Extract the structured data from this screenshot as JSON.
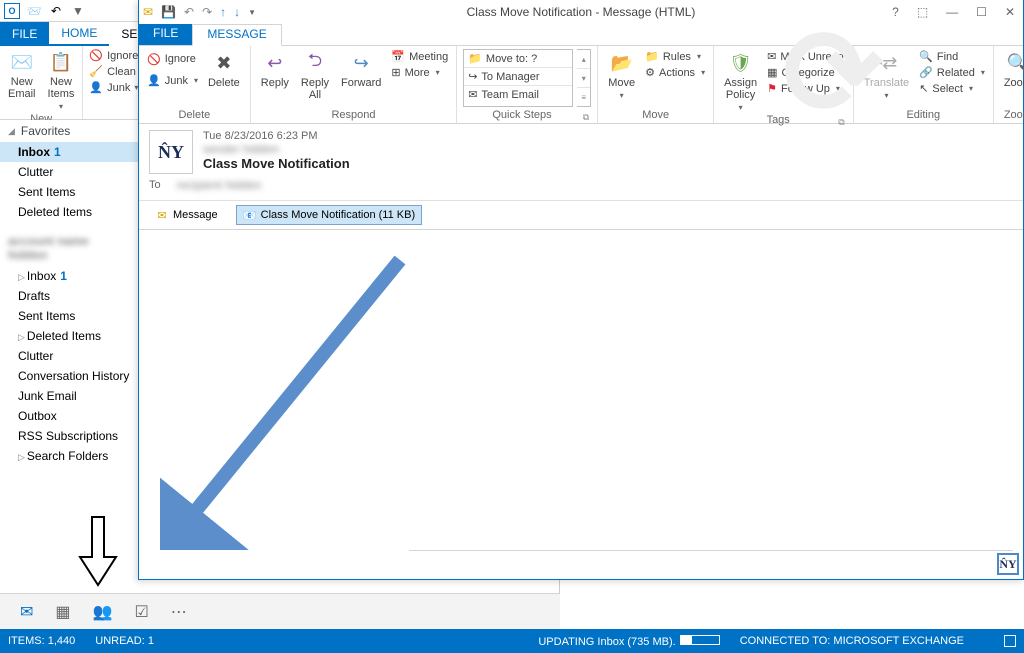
{
  "main": {
    "tabs": {
      "file": "FILE",
      "home": "HOME",
      "send_rcv": "SE"
    },
    "ribbon": {
      "new_email": "New\nEmail",
      "new_items": "New\nItems",
      "ignore": "Ignore",
      "clean": "Clean",
      "junk": "Junk",
      "group_new": "New"
    }
  },
  "nav": {
    "favorites": "Favorites",
    "inbox": "Inbox",
    "inbox_count": "1",
    "clutter": "Clutter",
    "sent": "Sent Items",
    "deleted": "Deleted Items",
    "account_blur": "account name hidden",
    "inbox2": "Inbox",
    "inbox2_count": "1",
    "drafts": "Drafts",
    "sent2": "Sent Items",
    "deleted2": "Deleted Items",
    "clutter2": "Clutter",
    "conv": "Conversation History",
    "junk": "Junk Email",
    "outbox": "Outbox",
    "rss": "RSS Subscriptions",
    "search": "Search Folders"
  },
  "status": {
    "items": "ITEMS: 1,440",
    "unread": "UNREAD: 1",
    "updating": "UPDATING Inbox (735 MB).",
    "connected": "CONNECTED TO: MICROSOFT EXCHANGE"
  },
  "msg": {
    "title": "Class Move Notification - Message (HTML)",
    "tabs": {
      "file": "FILE",
      "message": "MESSAGE"
    },
    "ribbon": {
      "ignore": "Ignore",
      "junk": "Junk",
      "delete_btn": "Delete",
      "delete": "Delete",
      "reply": "Reply",
      "reply_all": "Reply\nAll",
      "forward": "Forward",
      "meeting": "Meeting",
      "more": "More",
      "respond": "Respond",
      "moveto": "Move to: ?",
      "to_manager": "To Manager",
      "team_email": "Team Email",
      "quick": "Quick Steps",
      "move": "Move",
      "rules": "Rules",
      "actions": "Actions",
      "move_group": "Move",
      "assign": "Assign\nPolicy",
      "mark_unread": "Mark Unread",
      "categorize": "Categorize",
      "followup": "Follow Up",
      "tags": "Tags",
      "translate": "Translate",
      "find": "Find",
      "related": "Related",
      "select": "Select",
      "editing": "Editing",
      "zoom": "Zoom",
      "zoom_group": "Zoom"
    },
    "header": {
      "timestamp": "Tue 8/23/2016 6:23 PM",
      "from": "sender hidden",
      "subject": "Class Move Notification",
      "to_label": "To",
      "to": "recipient hidden"
    },
    "attach": {
      "message": "Message",
      "att_name": "Class Move Notification (11 KB)"
    }
  }
}
